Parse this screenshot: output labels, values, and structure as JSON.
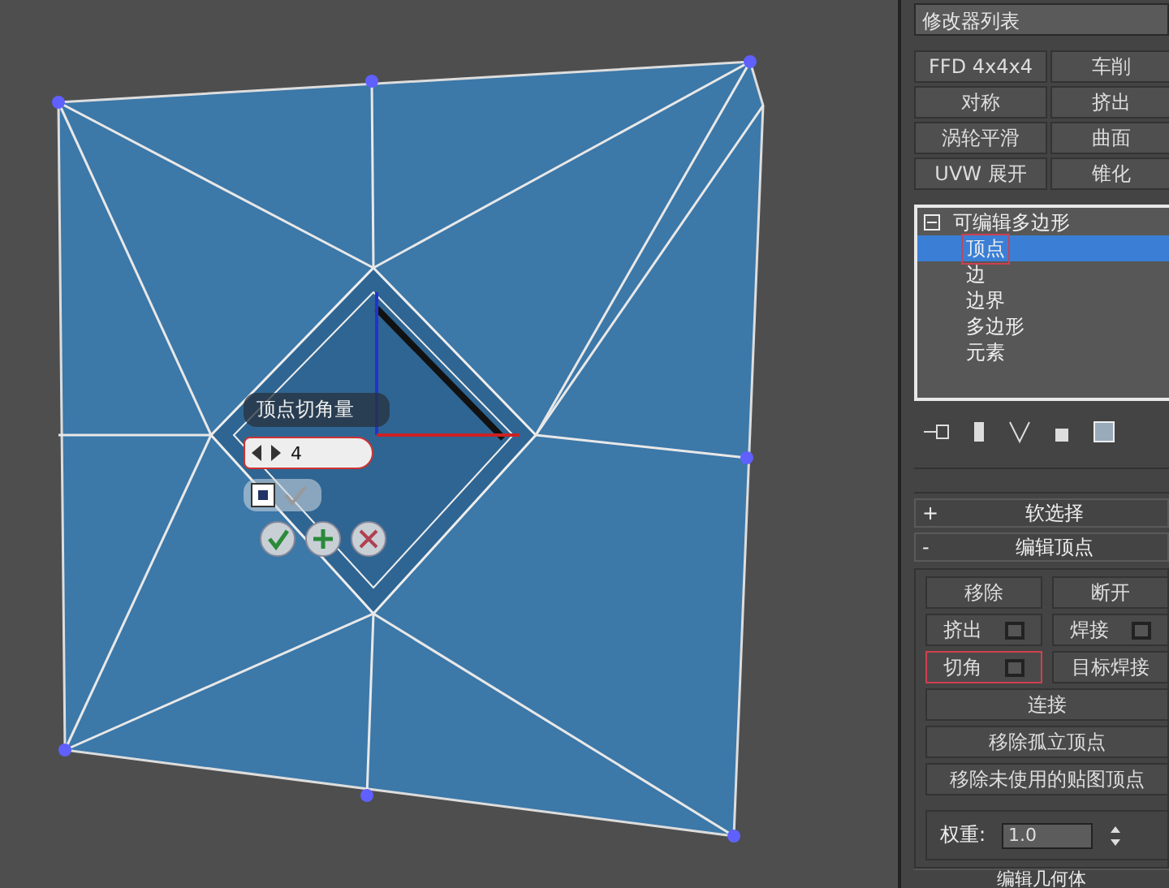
{
  "modifier_list": {
    "label": "修改器列表"
  },
  "modifier_buttons": [
    "FFD 4x4x4",
    "车削",
    "对称",
    "挤出",
    "涡轮平滑",
    "曲面",
    "UVW 展开",
    "锥化"
  ],
  "stack": {
    "label": "可编辑多边形",
    "expanded": true,
    "children": [
      {
        "label": "顶点",
        "selected": true
      },
      {
        "label": "边",
        "selected": false
      },
      {
        "label": "边界",
        "selected": false
      },
      {
        "label": "多边形",
        "selected": false
      },
      {
        "label": "元素",
        "selected": false
      }
    ]
  },
  "caddy": {
    "title": "顶点切角量",
    "value": "4"
  },
  "rollouts": [
    {
      "sign": "+",
      "title": "软选择"
    },
    {
      "sign": "-",
      "title": "编辑顶点"
    }
  ],
  "edit_vertices": {
    "buttons": [
      {
        "label": "移除",
        "kind": "plain",
        "highlighted": false
      },
      {
        "label": "断开",
        "kind": "plain",
        "highlighted": false
      },
      {
        "label": "挤出",
        "kind": "settings",
        "highlighted": false
      },
      {
        "label": "焊接",
        "kind": "settings",
        "highlighted": false
      },
      {
        "label": "切角",
        "kind": "settings",
        "highlighted": true
      },
      {
        "label": "目标焊接",
        "kind": "plain",
        "highlighted": false
      },
      {
        "label": "连接",
        "kind": "wide",
        "highlighted": false
      },
      {
        "label": "移除孤立顶点",
        "kind": "wide",
        "highlighted": false
      },
      {
        "label": "移除未使用的贴图顶点",
        "kind": "wide",
        "highlighted": false
      }
    ],
    "weight": {
      "label": "权重:",
      "value": "1.0"
    }
  },
  "next_rollout": {
    "title": "编辑几何体"
  }
}
